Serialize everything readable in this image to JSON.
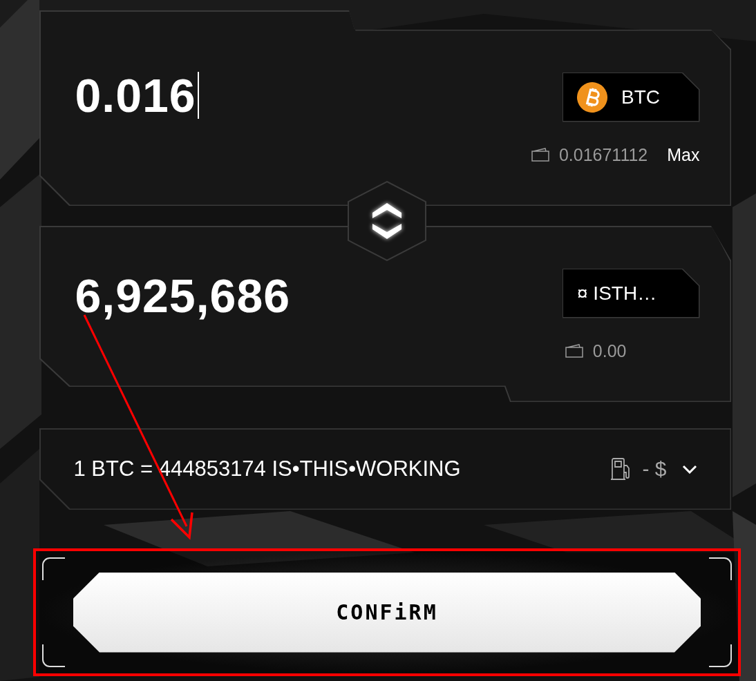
{
  "from_panel": {
    "amount": "0.016",
    "focused": true,
    "token": {
      "symbol": "BTC",
      "kind": "coin"
    },
    "balance": "0.01671112",
    "max_label": "Max"
  },
  "to_panel": {
    "amount": "6,925,686",
    "focused": false,
    "token": {
      "symbol": "¤ ISTH…"
    },
    "balance": "0.00"
  },
  "rate": {
    "text": "1 BTC = 444853174 IS•THIS•WORKING",
    "gas": "- $",
    "expanded": false
  },
  "confirm": {
    "label": "CONFiRM",
    "highlighted": true
  },
  "annotations": [
    {
      "kind": "arrow"
    }
  ]
}
